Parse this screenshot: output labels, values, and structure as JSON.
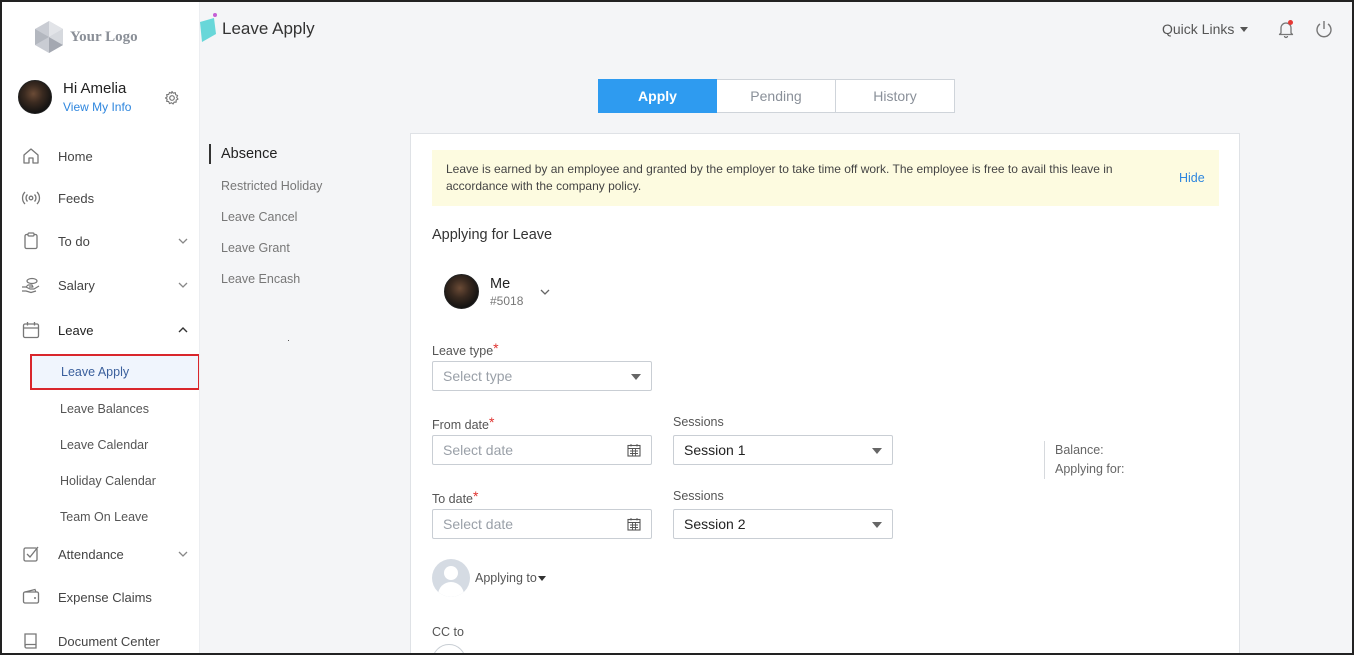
{
  "logo": {
    "text": "Your Logo"
  },
  "user": {
    "greeting": "Hi Amelia",
    "link": "View My Info"
  },
  "nav": {
    "items": [
      {
        "label": "Home",
        "icon": "home-icon"
      },
      {
        "label": "Feeds",
        "icon": "broadcast-icon"
      },
      {
        "label": "To do",
        "icon": "clipboard-icon",
        "expandable": true
      },
      {
        "label": "Salary",
        "icon": "hand-coin-icon",
        "expandable": true
      },
      {
        "label": "Leave",
        "icon": "calendar-icon",
        "expanded": true
      },
      {
        "label": "Attendance",
        "icon": "checkbox-icon",
        "expandable": true
      },
      {
        "label": "Expense Claims",
        "icon": "wallet-icon"
      },
      {
        "label": "Document Center",
        "icon": "book-icon"
      }
    ],
    "leave_sub": [
      "Leave Apply",
      "Leave Balances",
      "Leave Calendar",
      "Holiday Calendar",
      "Team On Leave"
    ],
    "active_sub": "Leave Apply"
  },
  "header": {
    "title": "Leave Apply",
    "quick_links": "Quick Links"
  },
  "tabs": [
    "Apply",
    "Pending",
    "History"
  ],
  "active_tab": "Apply",
  "submenu": {
    "active": "Absence",
    "items": [
      "Restricted Holiday",
      "Leave Cancel",
      "Leave Grant",
      "Leave Encash"
    ]
  },
  "notice": {
    "text": "Leave is earned by an employee and granted by the employer to take time off work. The employee is free to avail this leave in accordance with the company policy.",
    "hide": "Hide"
  },
  "form": {
    "title": "Applying for Leave",
    "employee": {
      "name": "Me",
      "id": "#5018"
    },
    "leave_type": {
      "label": "Leave type",
      "required_mark": "*",
      "placeholder": "Select type"
    },
    "from_date": {
      "label": "From date",
      "required_mark": "*",
      "placeholder": "Select date"
    },
    "to_date": {
      "label": "To date",
      "required_mark": "*",
      "placeholder": "Select date"
    },
    "from_sessions": {
      "label": "Sessions",
      "value": "Session 1"
    },
    "to_sessions": {
      "label": "Sessions",
      "value": "Session 2"
    },
    "balance_label": "Balance:",
    "applying_for_label": "Applying for:",
    "applying_to": "Applying to",
    "cc_to": "CC to"
  },
  "colors": {
    "accent": "#2e9bf0",
    "link": "#2e86de",
    "required": "#e0322f",
    "notice_bg": "#fdfbe0",
    "highlight_border": "#d9262c"
  }
}
